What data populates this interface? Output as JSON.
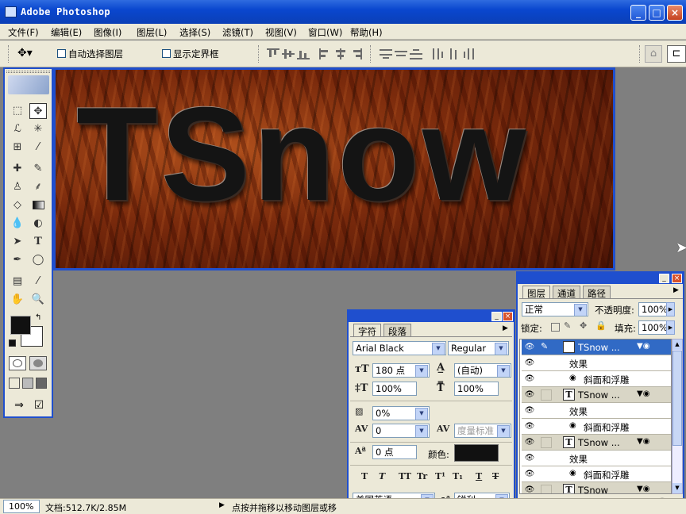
{
  "window": {
    "title": "Adobe Photoshop"
  },
  "menu": [
    "文件(F)",
    "编辑(E)",
    "图像(I)",
    "图层(L)",
    "选择(S)",
    "滤镜(T)",
    "视图(V)",
    "窗口(W)",
    "帮助(H)"
  ],
  "options_bar": {
    "auto_select_label": "自动选择图层",
    "show_bounds_label": "显示定界框"
  },
  "canvas": {
    "text": "TSnow"
  },
  "character_panel": {
    "tabs": [
      "字符",
      "段落"
    ],
    "font_family": "Arial Black",
    "font_style": "Regular",
    "size": "180 点",
    "leading": "(自动)",
    "vscale": "100%",
    "hscale": "100%",
    "baseline": "0%",
    "tracking": "0",
    "kerning": "度量标准",
    "baseline_shift": "0 点",
    "color_label": "颜色:",
    "color": "#111111",
    "language": "美国英语",
    "antialias_label": "a",
    "antialias": "锐利",
    "style_buttons": [
      "T",
      "T",
      "TT",
      "Tr",
      "T¹",
      "T₁",
      "T",
      "T"
    ]
  },
  "layers_panel": {
    "tabs": [
      "图层",
      "通道",
      "路径"
    ],
    "blend_mode": "正常",
    "opacity_label": "不透明度:",
    "opacity": "100%",
    "lock_label": "锁定:",
    "fill_label": "填充:",
    "fill": "100%",
    "layers": [
      {
        "name": "TSnow ...",
        "effects_label": "效果",
        "effect": "斜面和浮雕",
        "selected": true
      },
      {
        "name": "TSnow ...",
        "effects_label": "效果",
        "effect": "斜面和浮雕",
        "selected": false
      },
      {
        "name": "TSnow ...",
        "effects_label": "效果",
        "effect": "斜面和浮雕",
        "selected": false
      },
      {
        "name": "TSnow",
        "selected": false
      }
    ]
  },
  "status_bar": {
    "zoom": "100%",
    "doc": "文档:512.7K/2.85M",
    "hint": "点按并拖移以移动图层或移"
  },
  "colors": {
    "accent": "#1f4fce",
    "chrome": "#ece9d8",
    "foreground": "#111111",
    "background": "#ffffff"
  }
}
